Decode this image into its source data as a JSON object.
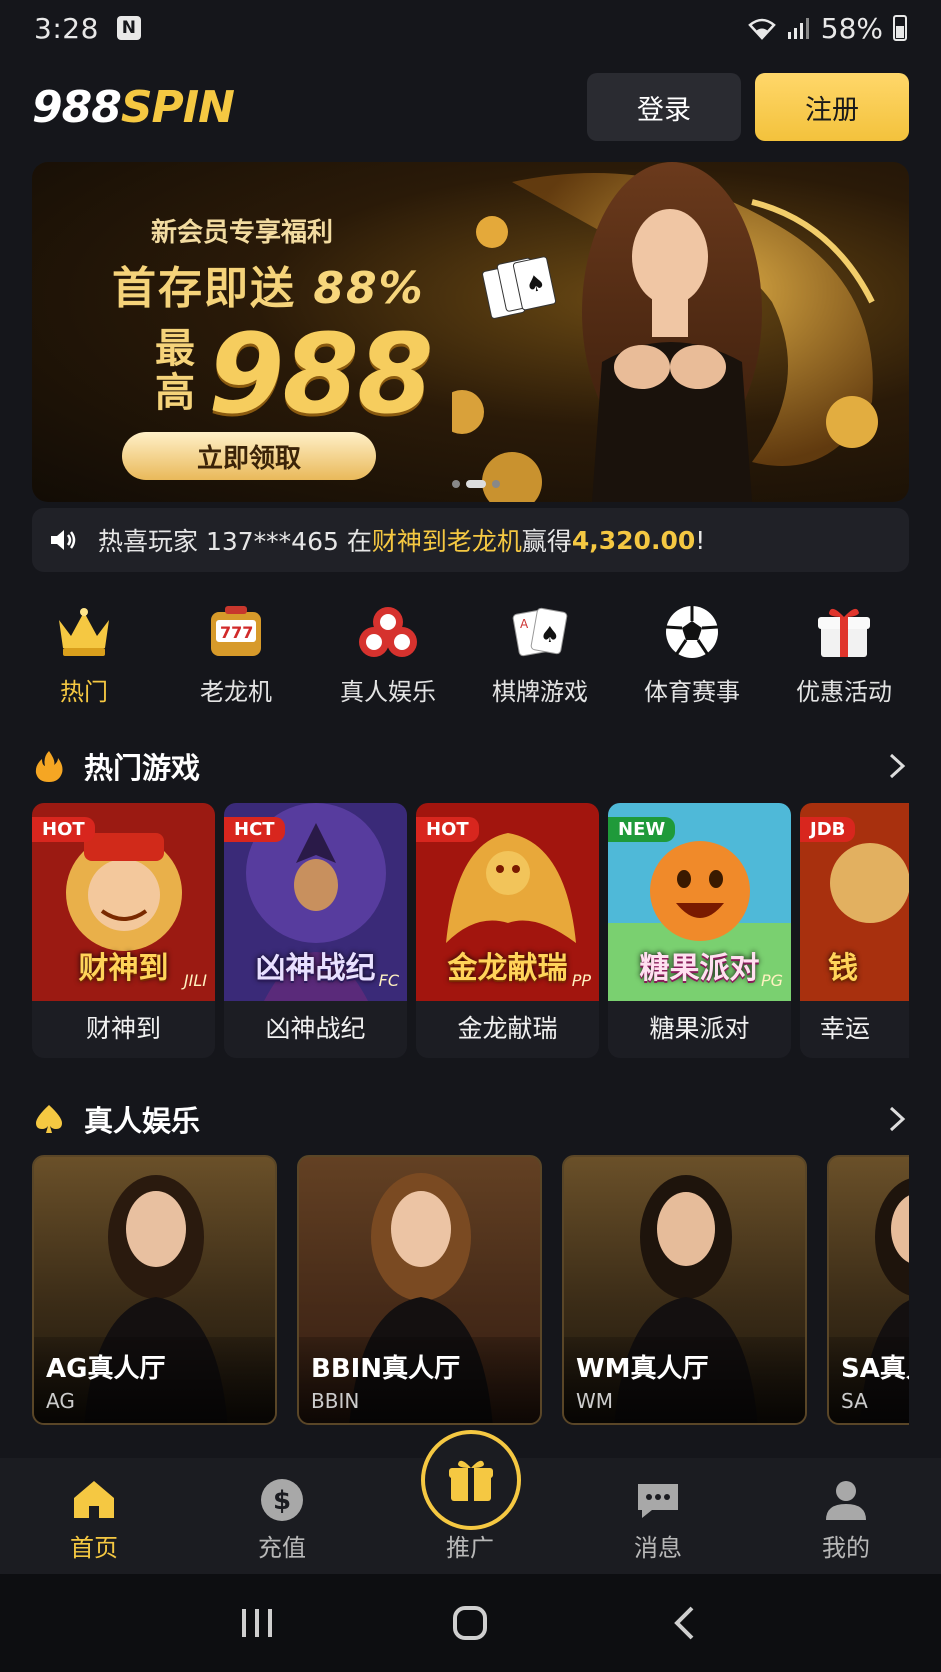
{
  "status_bar": {
    "time": "3:28",
    "notif": "N",
    "battery": "58%"
  },
  "header": {
    "logo_part1": "988",
    "logo_part2": "SPIN",
    "login_label": "登录",
    "register_label": "注册"
  },
  "banner": {
    "subtitle": "新会员专享福利",
    "main_text": "首存即送",
    "percent": "88%",
    "max_label": "最高",
    "amount": "988",
    "cta": "立即领取"
  },
  "marquee": {
    "prefix": "热喜玩家 137***465 在 ",
    "game": "财神到老龙机",
    "middle": " 赢得 ",
    "amount": "4,320.00",
    "suffix": "!"
  },
  "categories": [
    {
      "label": "热门",
      "icon": "crown-icon"
    },
    {
      "label": "老龙机",
      "icon": "slot-machine-icon"
    },
    {
      "label": "真人娱乐",
      "icon": "casino-chips-icon"
    },
    {
      "label": "棋牌游戏",
      "icon": "playing-cards-icon"
    },
    {
      "label": "体育赛事",
      "icon": "soccer-ball-icon"
    },
    {
      "label": "优惠活动",
      "icon": "gift-icon"
    }
  ],
  "hot_games": {
    "title": "热门游戏",
    "items": [
      {
        "tag": "HOT",
        "title_art": "财神到",
        "provider": "JILI",
        "name": "财神到"
      },
      {
        "tag": "HCT",
        "title_art": "凶神战纪",
        "provider": "FC",
        "name": "凶神战纪"
      },
      {
        "tag": "HOT",
        "title_art": "金龙献瑞",
        "provider": "PP",
        "name": "金龙献瑞"
      },
      {
        "tag": "NEW",
        "title_art": "糖果派对",
        "provider": "PG",
        "name": "糖果派对"
      },
      {
        "tag": "JDB",
        "title_art": "钱",
        "provider": "JDB",
        "name": "幸运"
      }
    ]
  },
  "live": {
    "title": "真人娱乐",
    "items": [
      {
        "name": "AG真人厅",
        "code": "AG"
      },
      {
        "name": "BBIN真人厅",
        "code": "BBIN"
      },
      {
        "name": "WM真人厅",
        "code": "WM"
      },
      {
        "name": "SA真人厅",
        "code": "SA"
      }
    ]
  },
  "bottom_nav": [
    {
      "label": "首页",
      "icon": "home-icon"
    },
    {
      "label": "充值",
      "icon": "dollar-icon"
    },
    {
      "label": "推广",
      "icon": "gift-icon"
    },
    {
      "label": "消息",
      "icon": "chat-icon"
    },
    {
      "label": "我的",
      "icon": "user-icon"
    }
  ],
  "colors": {
    "accent": "#f5c842",
    "background": "#15161b",
    "surface": "#202127"
  }
}
